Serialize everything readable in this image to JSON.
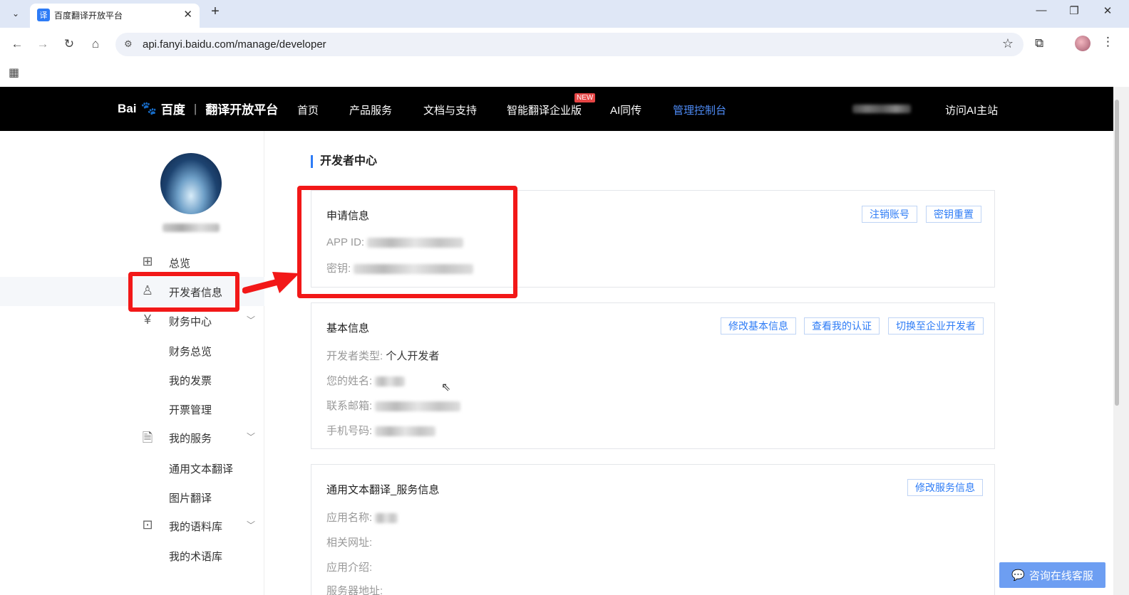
{
  "browser": {
    "tab_title": "百度翻译开放平台",
    "tab_favicon": "译",
    "url": "api.fanyi.baidu.com/manage/developer"
  },
  "header": {
    "logo_bai": "Bai",
    "logo_du": "百度",
    "logo_platform": "翻译开放平台",
    "nav": [
      "首页",
      "产品服务",
      "文档与支持",
      "智能翻译企业版",
      "AI同传",
      "管理控制台"
    ],
    "new_badge": "NEW",
    "visit_ai": "访问AI主站"
  },
  "sidebar": {
    "overview": "总览",
    "developer_info": "开发者信息",
    "finance_center": "财务中心",
    "finance_sub": [
      "财务总览",
      "我的发票",
      "开票管理"
    ],
    "my_services": "我的服务",
    "services_sub": [
      "通用文本翻译",
      "图片翻译"
    ],
    "my_corpus": "我的语料库",
    "corpus_sub": [
      "我的术语库"
    ]
  },
  "main": {
    "page_title": "开发者中心",
    "apply_info": {
      "title": "申请信息",
      "app_id_label": "APP ID:",
      "secret_label": "密钥:",
      "cancel_account": "注销账号",
      "reset_key": "密钥重置"
    },
    "basic_info": {
      "title": "基本信息",
      "dev_type_label": "开发者类型:",
      "dev_type_value": "个人开发者",
      "name_label": "您的姓名:",
      "email_label": "联系邮箱:",
      "phone_label": "手机号码:",
      "edit_basic": "修改基本信息",
      "view_cert": "查看我的认证",
      "switch_enterprise": "切换至企业开发者"
    },
    "service_info": {
      "title": "通用文本翻译_服务信息",
      "app_name_label": "应用名称:",
      "website_label": "相关网址:",
      "intro_label": "应用介绍:",
      "server_label": "服务器地址:",
      "edit_service": "修改服务信息"
    }
  },
  "help_button": "咨询在线客服",
  "colors": {
    "accent": "#2e7cf6",
    "highlight": "#f21818",
    "header_bg": "#000000"
  }
}
